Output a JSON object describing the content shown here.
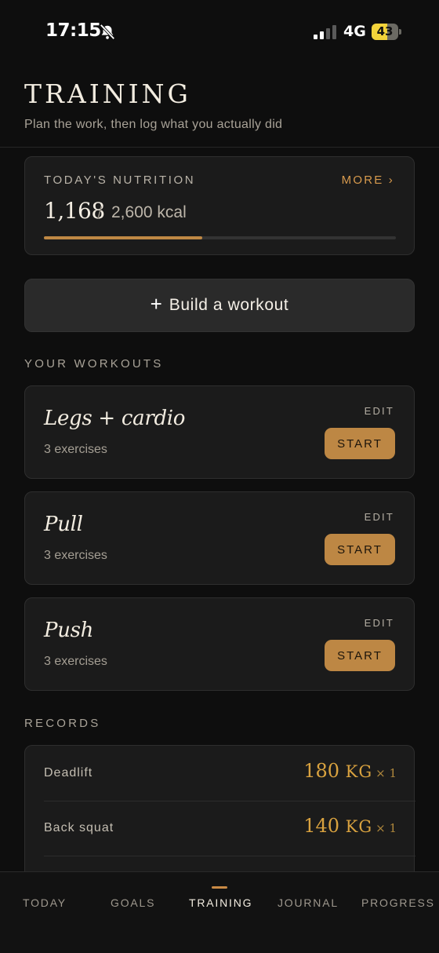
{
  "status_bar": {
    "time": "17:15",
    "network": "4G",
    "battery": "43",
    "icons": [
      "bell-slash-icon",
      "signal-icon",
      "battery-icon"
    ]
  },
  "header": {
    "title": "TRAINING",
    "subtitle": "Plan the work, then log what you actually did"
  },
  "nutrition": {
    "label": "TODAY'S NUTRITION",
    "more": "MORE ›",
    "current": "1,168",
    "separator": "/",
    "goal": "2,600 kcal",
    "progress_fraction": 0.449
  },
  "build_button": {
    "icon": "+",
    "label": "Build a workout"
  },
  "workouts": {
    "section_label": "YOUR WORKOUTS",
    "edit_label": "EDIT",
    "start_label": "START",
    "items": [
      {
        "name": "Legs + cardio",
        "count": "3 exercises"
      },
      {
        "name": "Pull",
        "count": "3 exercises"
      },
      {
        "name": "Push",
        "count": "3 exercises"
      }
    ]
  },
  "records": {
    "section_label": "RECORDS",
    "items": [
      {
        "name": "Deadlift",
        "value": "180",
        "unit": "KG",
        "reps": "× 1"
      },
      {
        "name": "Back squat",
        "value": "140",
        "unit": "KG",
        "reps": "× 1"
      }
    ]
  },
  "tabs": {
    "items": [
      {
        "label": "TODAY"
      },
      {
        "label": "GOALS"
      },
      {
        "label": "TRAINING"
      },
      {
        "label": "JOURNAL"
      },
      {
        "label": "PROGRESS"
      }
    ],
    "active": "TRAINING"
  },
  "colors": {
    "accent": "#bd8744",
    "record_gold": "#d9a23f",
    "background": "#0e0e0e",
    "card": "#1b1b1b"
  }
}
